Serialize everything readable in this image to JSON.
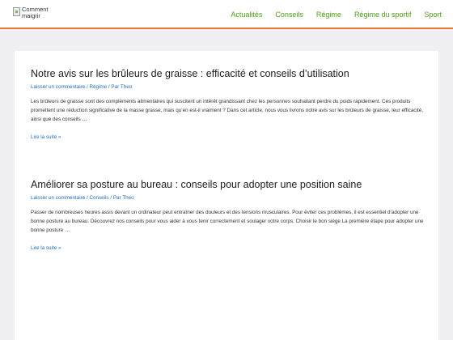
{
  "header": {
    "logo_alt": "Comment maigrir",
    "nav": [
      "Actualités",
      "Conseils",
      "Régime",
      "Régime du sportif",
      "Sport"
    ]
  },
  "articles": [
    {
      "title": "Notre avis sur les brûleurs de graisse : efficacité et conseils d’utilisation",
      "comment": "Laisser un commentaire",
      "category": "Régime",
      "author_prefix": "Par",
      "author": "Theo",
      "excerpt": "Les brûleurs de graisse sont des compléments alimentaires qui suscitent un intérêt grandissant chez les personnes souhaitant perdre du poids rapidement. Ces produits promettent une réduction significative de la masse grasse, mais qu’en est-il vraiment ? Dans cet article, nous vous livrons notre avis sur les brûleurs de graisse, leur efficacité, ainsi que des conseils …",
      "read_more": "Lire la suite »"
    },
    {
      "title": "Améliorer sa posture au bureau : conseils pour adopter une position saine",
      "comment": "Laisser un commentaire",
      "category": "Conseils",
      "author_prefix": "Par",
      "author": "Theo",
      "excerpt": "Passer de nombreuses heures assis devant un ordinateur peut entraîner des douleurs et des tensions musculaires. Pour éviter ces problèmes, il est essentiel d’adopter une bonne posture au bureau. Découvrez nos conseils pour vous aider à vous tenir correctement et soulager votre corps. Choisir le bon siège La première étape pour adopter une bonne posture …",
      "read_more": "Lire la suite »"
    }
  ],
  "colors": {
    "accent": "#e8772e",
    "nav_link": "#4c9e17",
    "link": "#1e6bc0",
    "background": "#f0f0f2"
  }
}
